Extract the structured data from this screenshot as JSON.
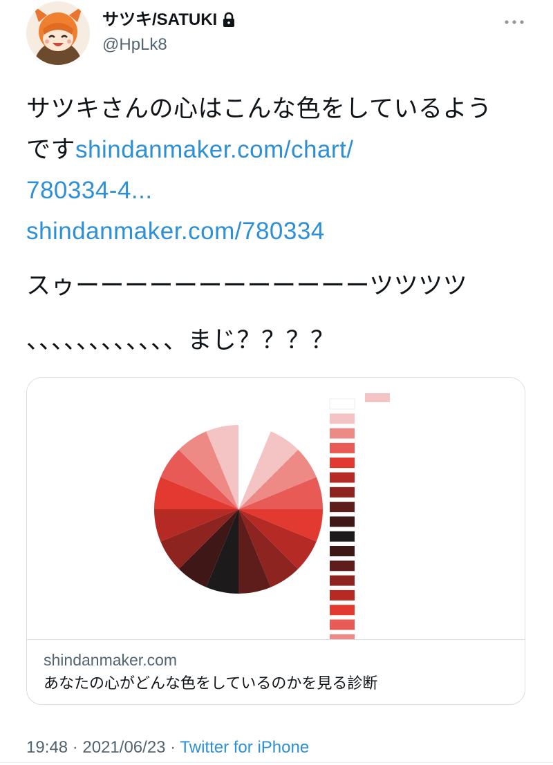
{
  "user": {
    "display_name": "サツキ/SATUKI",
    "handle": "@HpLk8",
    "avatar_icon": "avatar-image",
    "protected_icon": "lock-icon"
  },
  "tweet": {
    "text_line1": "サツキさんの心はこんな色をしているよう",
    "text_line2_prefix": "です",
    "link1_part1": "shindanmaker.com/chart/",
    "link1_part2": "780334-4...",
    "link2": "shindanmaker.com/780334",
    "text_line5": "スゥーーーーーーーーーーーーツツツツ",
    "text_line6": "、、、、、、、、、、、、まじ？？？？"
  },
  "card": {
    "domain": "shindanmaker.com",
    "description": "あなたの心がどんな色をしているのかを見る診断",
    "colors": {
      "white": "#ffffff",
      "pale_pink": "#f4c4c4",
      "salmon": "#ee8a86",
      "coral": "#e85a55",
      "red": "#e23a30",
      "deep_red": "#b52a24",
      "crimson": "#8e2420",
      "maroon": "#5e1d1b",
      "dark": "#3f1716",
      "black": "#1c1a1a"
    }
  },
  "meta": {
    "time": "19:48",
    "sep1": " · ",
    "date": "2021/06/23",
    "sep2": " · ",
    "source": "Twitter for iPhone"
  },
  "icons": {
    "more": "more-options-icon"
  }
}
